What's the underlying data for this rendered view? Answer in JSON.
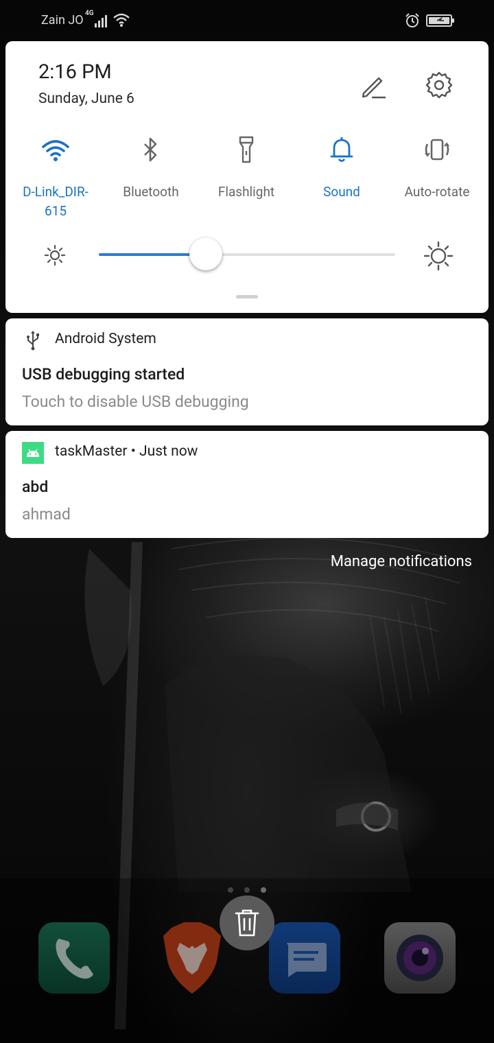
{
  "status_bar": {
    "carrier": "Zain JO",
    "network_type": "4G"
  },
  "quick_settings": {
    "time": "2:16 PM",
    "date": "Sunday, June 6",
    "tiles": [
      {
        "label": "D-Link_DIR-615",
        "label_line1": "D-Link_DIR-",
        "label_line2": "615",
        "icon": "wifi-icon",
        "active": true
      },
      {
        "label": "Bluetooth",
        "icon": "bluetooth-icon",
        "active": false
      },
      {
        "label": "Flashlight",
        "icon": "flashlight-icon",
        "active": false
      },
      {
        "label": "Sound",
        "icon": "bell-icon",
        "active": true
      },
      {
        "label": "Auto-rotate",
        "icon": "auto-rotate-icon",
        "active": false
      }
    ],
    "brightness_level": 0.36,
    "accent_color": "#1a73c7"
  },
  "notifications": [
    {
      "app": "Android System",
      "title": "USB debugging started",
      "text": "Touch to disable USB debugging",
      "icon": "usb-icon"
    },
    {
      "app": "taskMaster",
      "time": "Just now",
      "separator": "•",
      "title": "abd",
      "text": "ahmad",
      "icon": "android-icon"
    }
  ],
  "manage_notifications": "Manage notifications",
  "dock": {
    "apps": [
      {
        "name": "phone-app",
        "icon": "phone-icon"
      },
      {
        "name": "brave-app",
        "icon": "lion-icon"
      },
      {
        "name": "messages-app",
        "icon": "message-icon"
      },
      {
        "name": "camera-app",
        "icon": "camera-icon"
      }
    ],
    "page_count": 3,
    "current_page": 3
  }
}
